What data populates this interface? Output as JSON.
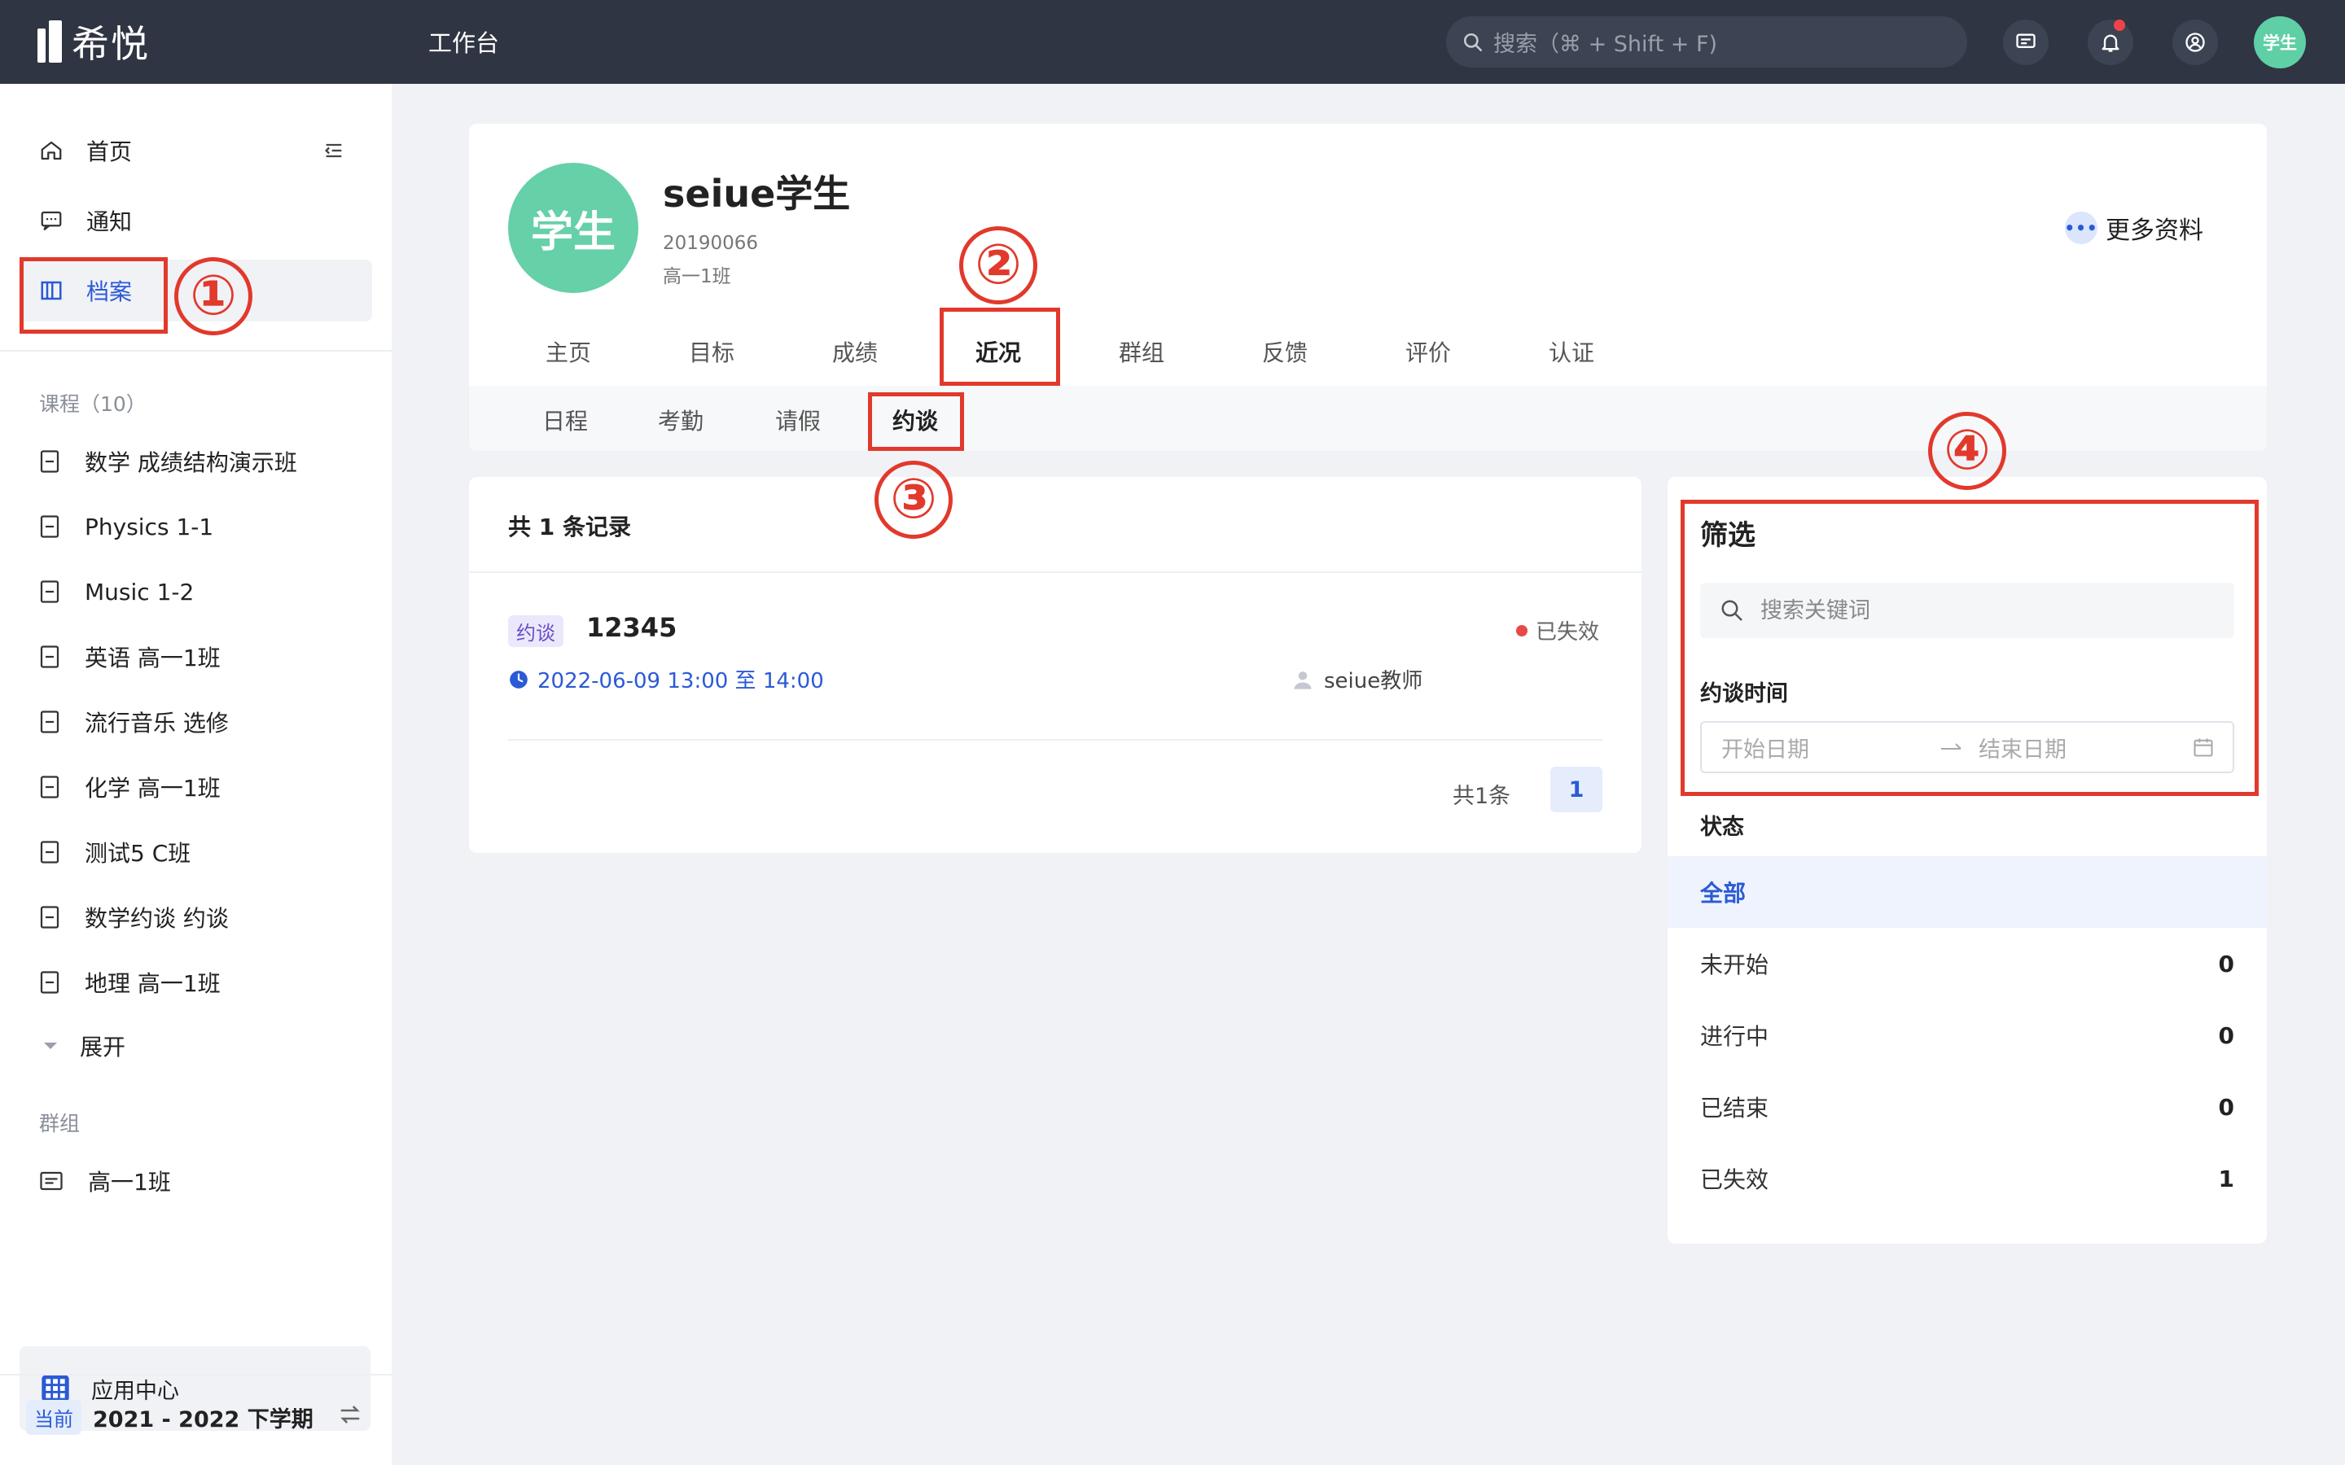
{
  "topbar": {
    "logo_text": "希悦",
    "workbench": "工作台",
    "search_placeholder": "搜索（⌘ + Shift + F)",
    "avatar_label": "学生"
  },
  "sidebar": {
    "items": [
      {
        "label": "首页",
        "icon": "home-icon"
      },
      {
        "label": "通知",
        "icon": "message-icon"
      },
      {
        "label": "档案",
        "icon": "archive-icon"
      }
    ],
    "courses_title": "课程（10）",
    "courses": [
      "数学 成绩结构演示班",
      "Physics 1-1",
      "Music 1-2",
      "英语 高一1班",
      "流行音乐 选修",
      "化学 高一1班",
      "测试5 C班",
      "数学约谈 约谈",
      "地理 高一1班"
    ],
    "expand_label": "展开",
    "groups_title": "群组",
    "groups": [
      "高一1班"
    ],
    "app_center": "应用中心",
    "term_badge": "当前",
    "term_label": "2021 - 2022 下学期"
  },
  "profile": {
    "avatar_label": "学生",
    "name": "seiue学生",
    "student_id": "20190066",
    "class_name": "高一1班",
    "more_label": "更多资料",
    "tabs": [
      "主页",
      "目标",
      "成绩",
      "近况",
      "群组",
      "反馈",
      "评价",
      "认证"
    ],
    "active_tab": "近况",
    "subtabs": [
      "日程",
      "考勤",
      "请假",
      "约谈"
    ],
    "active_subtab": "约谈"
  },
  "records": {
    "header": "共 1 条记录",
    "items": [
      {
        "tag": "约谈",
        "title": "12345",
        "status": "已失效",
        "time": "2022-06-09 13:00 至 14:00",
        "teacher": "seiue教师"
      }
    ],
    "total": "共1条",
    "page": "1"
  },
  "filter": {
    "title": "筛选",
    "search_placeholder": "搜索关键词",
    "time_label": "约谈时间",
    "start_placeholder": "开始日期",
    "end_placeholder": "结束日期",
    "status_label": "状态",
    "statuses": [
      {
        "label": "全部",
        "count": ""
      },
      {
        "label": "未开始",
        "count": "0"
      },
      {
        "label": "进行中",
        "count": "0"
      },
      {
        "label": "已结束",
        "count": "0"
      },
      {
        "label": "已失效",
        "count": "1"
      }
    ]
  },
  "annotations": [
    "①",
    "②",
    "③",
    "④"
  ],
  "colors": {
    "topbar": "#2f3542",
    "accent": "#2b5ad6",
    "avatar": "#66d0a8",
    "annotation": "#e1392c"
  }
}
